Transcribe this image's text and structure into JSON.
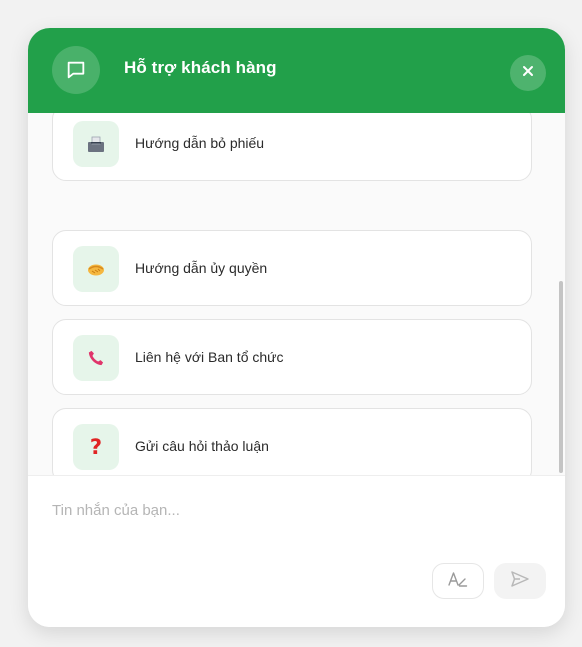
{
  "header": {
    "title": "Hỗ trợ khách hàng",
    "bg_color": "#22a04a",
    "icon": "chat-bubble-icon",
    "close_icon": "close-icon"
  },
  "menu": {
    "items": [
      {
        "label": "Hướng dẫn bỏ phiếu",
        "icon": "ballot-box-icon"
      },
      {
        "label": "Hướng dẫn ủy quyền",
        "icon": "handshake-icon"
      },
      {
        "label": "Liên hệ với Ban tổ chức",
        "icon": "phone-icon"
      },
      {
        "label": "Gửi câu hỏi thảo luận",
        "icon": "question-mark-icon"
      }
    ]
  },
  "composer": {
    "placeholder": "Tin nhắn của bạn...",
    "format_icon": "text-format-icon",
    "send_icon": "send-icon"
  }
}
